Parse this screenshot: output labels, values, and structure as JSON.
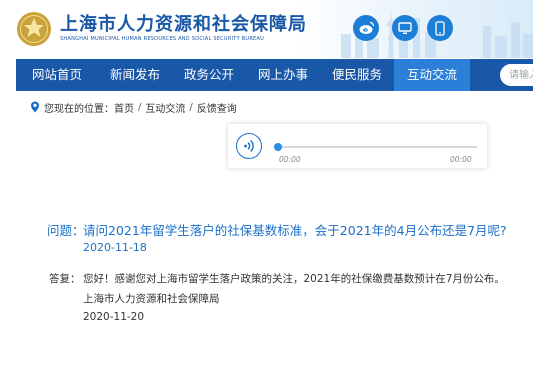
{
  "header": {
    "title": "上海市人力资源和社会保障局",
    "subtitle": "SHANGHAI MUNICIPAL HUMAN RESOURCES AND SOCIAL SECURITY BUREAU",
    "icons": [
      "weibo-icon",
      "monitor-icon",
      "mobile-icon"
    ]
  },
  "nav": {
    "items": [
      {
        "label": "网站首页"
      },
      {
        "label": "新闻发布"
      },
      {
        "label": "政务公开"
      },
      {
        "label": "网上办事"
      },
      {
        "label": "便民服务"
      },
      {
        "label": "互动交流",
        "active": true
      }
    ],
    "search_placeholder": "请输入"
  },
  "breadcrumb": {
    "prefix": "您现在的位置：",
    "items": [
      "首页",
      "互动交流",
      "反馈查询"
    ]
  },
  "player": {
    "current_time": "00:00",
    "total_time": "00:00",
    "progress": 0
  },
  "question": {
    "label": "问题：",
    "text": "请问2021年留学生落户的社保基数标准，会于2021年的4月公布还是7月呢?",
    "date": "2020-11-18"
  },
  "answer": {
    "label": "答复：",
    "text": "您好！感谢您对上海市留学生落户政策的关注，2021年的社保缴费基数预计在7月份公布。",
    "org": "上海市人力资源和社会保障局",
    "date": "2020-11-20"
  },
  "colors": {
    "brand_blue": "#1957a7",
    "nav_active": "#2b7fd8",
    "link_blue": "#1c70c9",
    "icon_blue": "#1c7ed6"
  }
}
